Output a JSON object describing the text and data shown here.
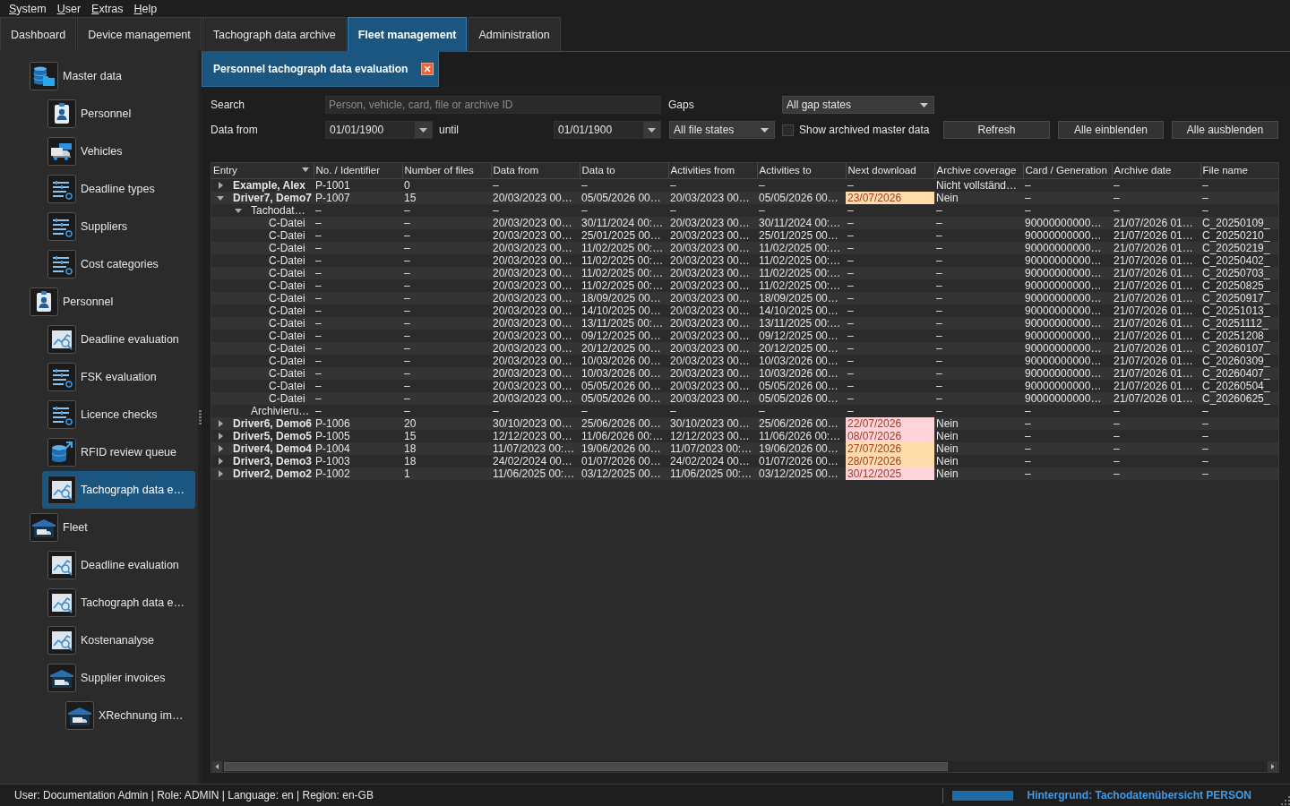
{
  "menu": [
    "System",
    "User",
    "Extras",
    "Help"
  ],
  "tabs": [
    {
      "label": "Dashboard",
      "selected": false
    },
    {
      "label": "Device management",
      "selected": false
    },
    {
      "label": "Tachograph data archive",
      "selected": false
    },
    {
      "label": "Fleet management",
      "selected": true
    },
    {
      "label": "Administration",
      "selected": false
    }
  ],
  "sidebar": {
    "items": [
      {
        "label": "Master data",
        "kind": "database",
        "selected": false,
        "children": [
          {
            "label": "Personnel",
            "kind": "badge",
            "selected": false
          },
          {
            "label": "Vehicles",
            "kind": "vehicle",
            "selected": false
          },
          {
            "label": "Deadline types",
            "kind": "list",
            "selected": false
          },
          {
            "label": "Suppliers",
            "kind": "list",
            "selected": false
          },
          {
            "label": "Cost categories",
            "kind": "list",
            "selected": false
          }
        ]
      },
      {
        "label": "Personnel",
        "kind": "badge",
        "selected": false,
        "children": [
          {
            "label": "Deadline evaluation",
            "kind": "chart",
            "selected": false
          },
          {
            "label": "FSK evaluation",
            "kind": "list",
            "selected": false
          },
          {
            "label": "Licence checks",
            "kind": "list",
            "selected": false
          },
          {
            "label": "RFID review queue",
            "kind": "export",
            "selected": false
          },
          {
            "label": "Tachograph data e…",
            "kind": "chart",
            "selected": true
          }
        ]
      },
      {
        "label": "Fleet",
        "kind": "depot",
        "selected": false,
        "children": [
          {
            "label": "Deadline evaluation",
            "kind": "chart",
            "selected": false
          },
          {
            "label": "Tachograph data e…",
            "kind": "chart",
            "selected": false
          },
          {
            "label": "Kostenanalyse",
            "kind": "chart",
            "selected": false
          },
          {
            "label": "Supplier invoices",
            "kind": "depot",
            "selected": false,
            "children": [
              {
                "label": "XRechnung im…",
                "kind": "depot",
                "selected": false
              }
            ]
          }
        ]
      }
    ]
  },
  "document_tab": {
    "title": "Personnel tachograph data evaluation"
  },
  "filters": {
    "search": {
      "label": "Search",
      "placeholder": "Person, vehicle, card, file or archive ID"
    },
    "gaps": {
      "label": "Gaps",
      "value": "All gap states"
    },
    "data_from": {
      "label": "Data from",
      "value": "01/01/1900"
    },
    "until": {
      "label": "until",
      "value": "01/01/1900"
    },
    "file_states": {
      "value": "All file states"
    },
    "show_archived": {
      "label": "Show archived master data",
      "checked": false
    },
    "buttons": [
      "Refresh",
      "Alle einblenden",
      "Alle ausblenden"
    ]
  },
  "table": {
    "columns": [
      "Entry",
      "No. / Identifier",
      "Number of files",
      "Data from",
      "Data to",
      "Activities from",
      "Activities to",
      "Next download",
      "Archive coverage",
      "Card / Generation",
      "Archive date",
      "File name"
    ],
    "rows": [
      {
        "expanded": false,
        "cells": [
          "Example, Alex",
          "P-1001",
          "0",
          "–",
          "–",
          "–",
          "–",
          "–",
          "Nicht vollständ…",
          "–",
          "–",
          "–"
        ]
      },
      {
        "expanded": true,
        "cells": [
          "Driver7, Demo7",
          "P-1007",
          "15",
          "20/03/2023 00…",
          "05/05/2026 00…",
          "20/03/2023 00…",
          "05/05/2026 00…",
          {
            "text": "23/07/2026",
            "color": "#ffdcaa"
          },
          "Nein",
          "–",
          "–",
          "–"
        ],
        "children": [
          {
            "expanded": true,
            "cells": [
              "Tachodat…",
              "–",
              "–",
              "–",
              "–",
              "–",
              "–",
              "–",
              "–",
              "–",
              "–",
              "–"
            ],
            "children": [
              {
                "cells": [
                  "C-Datei",
                  "–",
                  "–",
                  "20/03/2023 00…",
                  "30/11/2024 00:…",
                  "20/03/2023 00…",
                  "30/11/2024 00:…",
                  "–",
                  "–",
                  "90000000000…",
                  "21/07/2026 01…",
                  "C_20250109_"
                ]
              },
              {
                "cells": [
                  "C-Datei",
                  "–",
                  "–",
                  "20/03/2023 00…",
                  "25/01/2025 00…",
                  "20/03/2023 00…",
                  "25/01/2025 00…",
                  "–",
                  "–",
                  "90000000000…",
                  "21/07/2026 01…",
                  "C_20250210_"
                ]
              },
              {
                "cells": [
                  "C-Datei",
                  "–",
                  "–",
                  "20/03/2023 00…",
                  "11/02/2025 00:…",
                  "20/03/2023 00…",
                  "11/02/2025 00:…",
                  "–",
                  "–",
                  "90000000000…",
                  "21/07/2026 01…",
                  "C_20250219_"
                ]
              },
              {
                "cells": [
                  "C-Datei",
                  "–",
                  "–",
                  "20/03/2023 00…",
                  "11/02/2025 00:…",
                  "20/03/2023 00…",
                  "11/02/2025 00:…",
                  "–",
                  "–",
                  "90000000000…",
                  "21/07/2026 01…",
                  "C_20250402_"
                ]
              },
              {
                "cells": [
                  "C-Datei",
                  "–",
                  "–",
                  "20/03/2023 00…",
                  "11/02/2025 00:…",
                  "20/03/2023 00…",
                  "11/02/2025 00:…",
                  "–",
                  "–",
                  "90000000000…",
                  "21/07/2026 01…",
                  "C_20250703_"
                ]
              },
              {
                "cells": [
                  "C-Datei",
                  "–",
                  "–",
                  "20/03/2023 00…",
                  "11/02/2025 00:…",
                  "20/03/2023 00…",
                  "11/02/2025 00:…",
                  "–",
                  "–",
                  "90000000000…",
                  "21/07/2026 01…",
                  "C_20250825_"
                ]
              },
              {
                "cells": [
                  "C-Datei",
                  "–",
                  "–",
                  "20/03/2023 00…",
                  "18/09/2025 00…",
                  "20/03/2023 00…",
                  "18/09/2025 00…",
                  "–",
                  "–",
                  "90000000000…",
                  "21/07/2026 01…",
                  "C_20250917_"
                ]
              },
              {
                "cells": [
                  "C-Datei",
                  "–",
                  "–",
                  "20/03/2023 00…",
                  "14/10/2025 00…",
                  "20/03/2023 00…",
                  "14/10/2025 00…",
                  "–",
                  "–",
                  "90000000000…",
                  "21/07/2026 01…",
                  "C_20251013_"
                ]
              },
              {
                "cells": [
                  "C-Datei",
                  "–",
                  "–",
                  "20/03/2023 00…",
                  "13/11/2025 00:…",
                  "20/03/2023 00…",
                  "13/11/2025 00:…",
                  "–",
                  "–",
                  "90000000000…",
                  "21/07/2026 01…",
                  "C_20251112_"
                ]
              },
              {
                "cells": [
                  "C-Datei",
                  "–",
                  "–",
                  "20/03/2023 00…",
                  "09/12/2025 00…",
                  "20/03/2023 00…",
                  "09/12/2025 00…",
                  "–",
                  "–",
                  "90000000000…",
                  "21/07/2026 01…",
                  "C_20251208_"
                ]
              },
              {
                "cells": [
                  "C-Datei",
                  "–",
                  "–",
                  "20/03/2023 00…",
                  "20/12/2025 00…",
                  "20/03/2023 00…",
                  "20/12/2025 00…",
                  "–",
                  "–",
                  "90000000000…",
                  "21/07/2026 01…",
                  "C_20260107_"
                ]
              },
              {
                "cells": [
                  "C-Datei",
                  "–",
                  "–",
                  "20/03/2023 00…",
                  "10/03/2026 00…",
                  "20/03/2023 00…",
                  "10/03/2026 00…",
                  "–",
                  "–",
                  "90000000000…",
                  "21/07/2026 01…",
                  "C_20260309_"
                ]
              },
              {
                "cells": [
                  "C-Datei",
                  "–",
                  "–",
                  "20/03/2023 00…",
                  "10/03/2026 00…",
                  "20/03/2023 00…",
                  "10/03/2026 00…",
                  "–",
                  "–",
                  "90000000000…",
                  "21/07/2026 01…",
                  "C_20260407_"
                ]
              },
              {
                "cells": [
                  "C-Datei",
                  "–",
                  "–",
                  "20/03/2023 00…",
                  "05/05/2026 00…",
                  "20/03/2023 00…",
                  "05/05/2026 00…",
                  "–",
                  "–",
                  "90000000000…",
                  "21/07/2026 01…",
                  "C_20260504_"
                ]
              },
              {
                "cells": [
                  "C-Datei",
                  "–",
                  "–",
                  "20/03/2023 00…",
                  "05/05/2026 00…",
                  "20/03/2023 00…",
                  "05/05/2026 00…",
                  "–",
                  "–",
                  "90000000000…",
                  "21/07/2026 01…",
                  "C_20260625_"
                ]
              }
            ]
          },
          {
            "cells": [
              "Archivieru…",
              "–",
              "–",
              "–",
              "–",
              "–",
              "–",
              "–",
              "–",
              "–",
              "–",
              "–"
            ]
          }
        ]
      },
      {
        "expanded": false,
        "cells": [
          "Driver6, Demo6",
          "P-1006",
          "20",
          "30/10/2023 00…",
          "25/06/2026 00…",
          "30/10/2023 00…",
          "25/06/2026 00…",
          {
            "text": "22/07/2026",
            "color": "#ffd3da"
          },
          "Nein",
          "–",
          "–",
          "–"
        ]
      },
      {
        "expanded": false,
        "cells": [
          "Driver5, Demo5",
          "P-1005",
          "15",
          "12/12/2023 00…",
          "11/06/2026 00:…",
          "12/12/2023 00…",
          "11/06/2026 00:…",
          {
            "text": "08/07/2026",
            "color": "#ffd3da"
          },
          "Nein",
          "–",
          "–",
          "–"
        ]
      },
      {
        "expanded": false,
        "cells": [
          "Driver4, Demo4",
          "P-1004",
          "18",
          "11/07/2023 00:…",
          "19/06/2026 00…",
          "11/07/2023 00:…",
          "19/06/2026 00…",
          {
            "text": "27/07/2026",
            "color": "#ffdcaa"
          },
          "Nein",
          "–",
          "–",
          "–"
        ]
      },
      {
        "expanded": false,
        "cells": [
          "Driver3, Demo3",
          "P-1003",
          "18",
          "24/02/2024 00…",
          "01/07/2026 00…",
          "24/02/2024 00…",
          "01/07/2026 00…",
          {
            "text": "28/07/2026",
            "color": "#ffdcaa"
          },
          "Nein",
          "–",
          "–",
          "–"
        ]
      },
      {
        "expanded": false,
        "cells": [
          "Driver2, Demo2",
          "P-1002",
          "1",
          "11/06/2025 00:…",
          "03/12/2025 00…",
          "11/06/2025 00:…",
          "03/12/2025 00…",
          {
            "text": "30/12/2025",
            "color": "#ffd3da"
          },
          "Nein",
          "–",
          "–",
          "–"
        ]
      }
    ]
  },
  "status_bar": {
    "text": "User: Documentation Admin | Role: ADMIN | Language: en | Region: en-GB",
    "progress": {
      "level": 1
    },
    "background_task": "Hintergrund: Tachodatenübersicht PERSON"
  }
}
